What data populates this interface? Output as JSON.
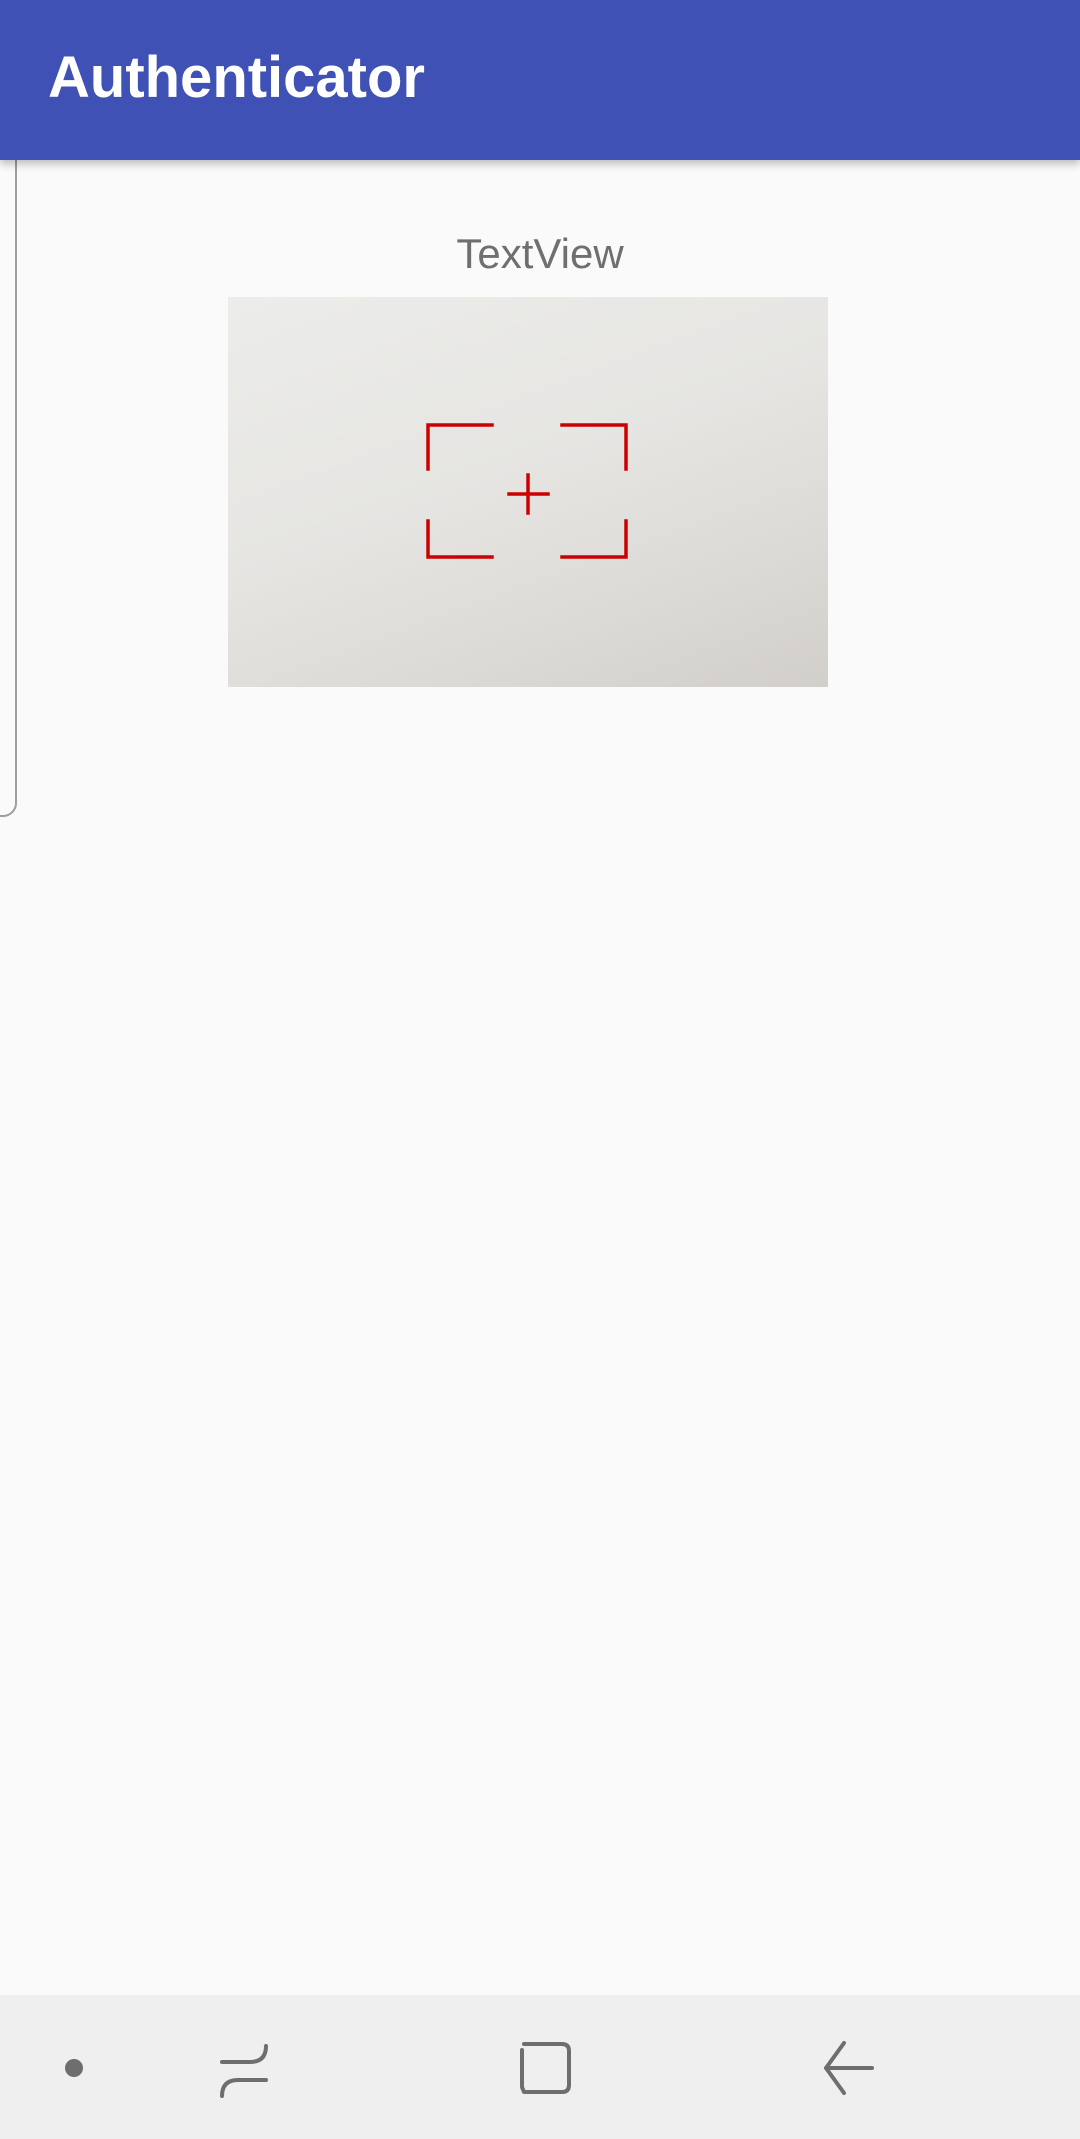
{
  "app_bar": {
    "title": "Authenticator",
    "color": "#3f51b5"
  },
  "main": {
    "text_view": "TextView",
    "viewfinder": {
      "icon": "viewfinder-crosshair-icon",
      "color": "#cc0000"
    }
  },
  "nav_bar": {
    "buttons": [
      {
        "icon": "dot-icon"
      },
      {
        "icon": "recent-apps-icon"
      },
      {
        "icon": "home-icon"
      },
      {
        "icon": "back-icon"
      }
    ]
  }
}
